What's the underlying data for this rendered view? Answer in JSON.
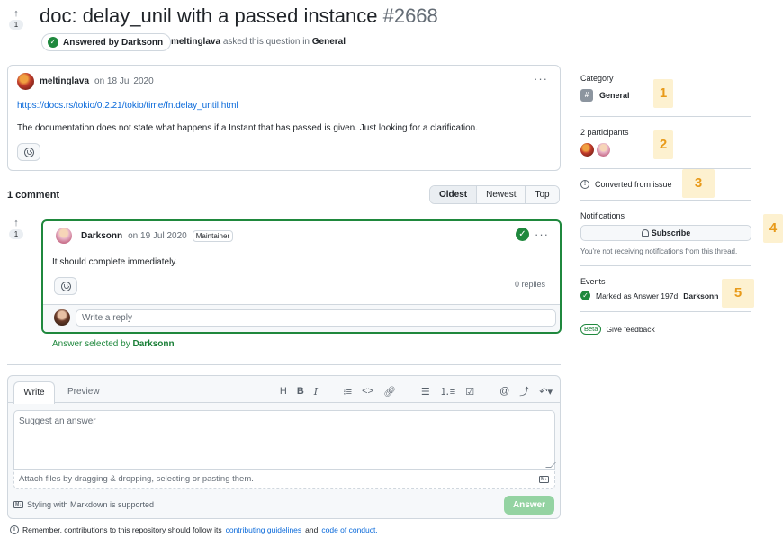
{
  "discussion": {
    "vote_count": "1",
    "title": "doc: delay_unil with a passed instance",
    "number": "#2668",
    "answered_label": "Answered by Darksonn",
    "asker": "meltinglava",
    "asked_text": "asked this question in",
    "category": "General"
  },
  "post": {
    "author": "meltinglava",
    "date": "on 18 Jul 2020",
    "link": "https://docs.rs/tokio/0.2.21/tokio/time/fn.delay_until.html",
    "body": "The documentation does not state what happens if a Instant that has passed is given. Just looking for a clarification."
  },
  "comments": {
    "count_label": "1 comment",
    "sort_options": [
      "Oldest",
      "Newest",
      "Top"
    ]
  },
  "answer": {
    "vote_count": "1",
    "author": "Darksonn",
    "date": "on 19 Jul 2020",
    "badge": "Maintainer",
    "body": "It should complete immediately.",
    "replies": "0 replies",
    "reply_placeholder": "Write a reply",
    "selected_prefix": "Answer selected by",
    "selected_by": "Darksonn"
  },
  "editor": {
    "tab_write": "Write",
    "tab_preview": "Preview",
    "toolbar": [
      "H",
      "B",
      "I",
      "heading-list",
      "code",
      "link",
      "bullet-list",
      "numbered-list",
      "task-list",
      "mention",
      "reference",
      "reply"
    ],
    "placeholder": "Suggest an answer",
    "attach_text": "Attach files by dragging & dropping, selecting or pasting them.",
    "markdown_note": "Styling with Markdown is supported",
    "submit_label": "Answer"
  },
  "footer": {
    "prefix": "Remember, contributions to this repository should follow its",
    "guidelines": "contributing guidelines",
    "and": "and",
    "coc": "code of conduct."
  },
  "sidebar": {
    "category_heading": "Category",
    "category_value": "General",
    "participants_heading": "2 participants",
    "converted": "Converted from issue",
    "notifications_heading": "Notifications",
    "subscribe_label": "Subscribe",
    "notifications_note": "You're not receiving notifications from this thread.",
    "events_heading": "Events",
    "event_text": "Marked as Answer 197d",
    "event_user": "Darksonn",
    "beta_badge": "Beta",
    "feedback": "Give feedback",
    "callouts": [
      "1",
      "2",
      "3",
      "4",
      "5"
    ]
  },
  "colors": {
    "accent_green": "#1f883d",
    "link_blue": "#0969da",
    "callout_bg": "#fdf1d0",
    "callout_text": "#e89a1a"
  }
}
